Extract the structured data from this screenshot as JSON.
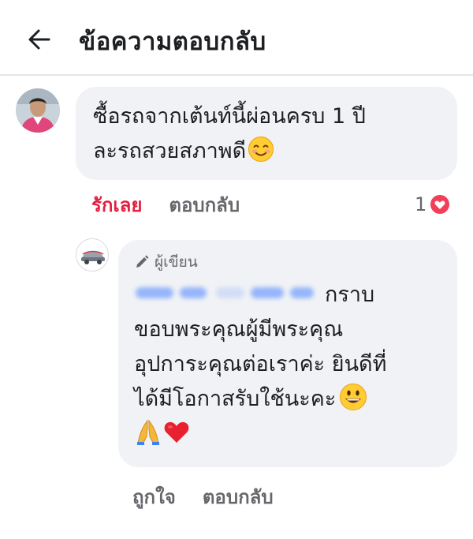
{
  "header": {
    "title": "ข้อความตอบกลับ",
    "back_icon": "arrow-left-icon"
  },
  "comment": {
    "text": "ซื้อรถจากเต้นท์นี้ผ่อนครบ 1 ปี\nละรถสวยสภาพดี",
    "emoji": "smiling-face-icon",
    "actions": {
      "like_label": "รักเลย",
      "reply_label": "ตอบกลับ"
    },
    "reaction_count": "1",
    "reaction_icon": "heart-icon",
    "colors": {
      "liked": "#e41e3f",
      "muted": "#65676b"
    }
  },
  "reply": {
    "author_label": "ผู้เขียน",
    "author_icon": "pencil-icon",
    "text_line1": "กราบ",
    "text_rest": "ขอบพระคุณผู้มีพระคุณ\nอุปการะคุณต่อเราค่ะ ยินดีที่\nได้มีโอกาสรับใช้นะคะ",
    "emojis": [
      "grinning-face-icon",
      "folded-hands-icon",
      "red-heart-icon"
    ],
    "actions": {
      "like_label": "ถูกใจ",
      "reply_label": "ตอบกลับ"
    }
  }
}
